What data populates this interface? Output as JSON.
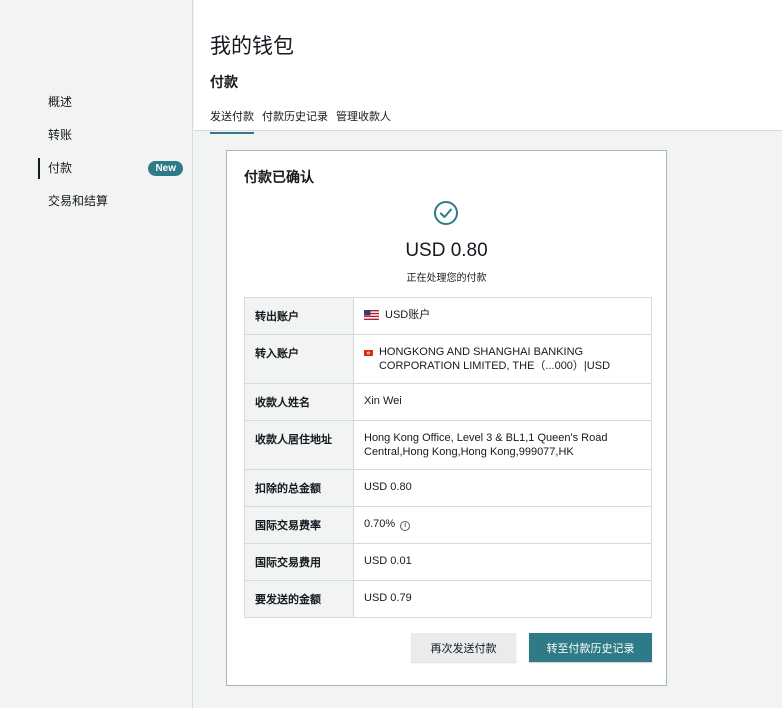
{
  "sidebar": {
    "items": [
      {
        "label": "概述"
      },
      {
        "label": "转账"
      },
      {
        "label": "付款",
        "badge": "New",
        "active": true
      },
      {
        "label": "交易和结算"
      }
    ]
  },
  "header": {
    "title": "我的钱包",
    "section": "付款",
    "tabs": [
      {
        "label": "发送付款",
        "active": true
      },
      {
        "label": "付款历史记录"
      },
      {
        "label": "管理收款人"
      }
    ]
  },
  "card": {
    "title": "付款已确认",
    "icon": "check-circle-icon",
    "amount": "USD 0.80",
    "status": "正在处理您的付款",
    "rows": [
      {
        "key": "转出账户",
        "value": "USD账户",
        "flag": "us-flag-icon"
      },
      {
        "key": "转入账户",
        "value": "HONGKONG AND SHANGHAI BANKING CORPORATION LIMITED, THE（...000）|USD",
        "flag": "hk-flag-icon"
      },
      {
        "key": "收款人姓名",
        "value": "Xin Wei"
      },
      {
        "key": "收款人居住地址",
        "value": "Hong Kong Office, Level 3 & BL1,1 Queen's Road Central,Hong Kong,Hong Kong,999077,HK"
      },
      {
        "key": "扣除的总金额",
        "value": "USD 0.80"
      },
      {
        "key": "国际交易费率",
        "value": "0.70%",
        "info_icon": "info-icon"
      },
      {
        "key": "国际交易费用",
        "value": "USD 0.01"
      },
      {
        "key": "要发送的金额",
        "value": "USD 0.79"
      }
    ],
    "buttons": {
      "secondary": "再次发送付款",
      "primary": "转至付款历史记录"
    }
  },
  "colors": {
    "accent": "#2e7b87",
    "background": "#f2f3f3",
    "border": "#d5dbdb"
  }
}
